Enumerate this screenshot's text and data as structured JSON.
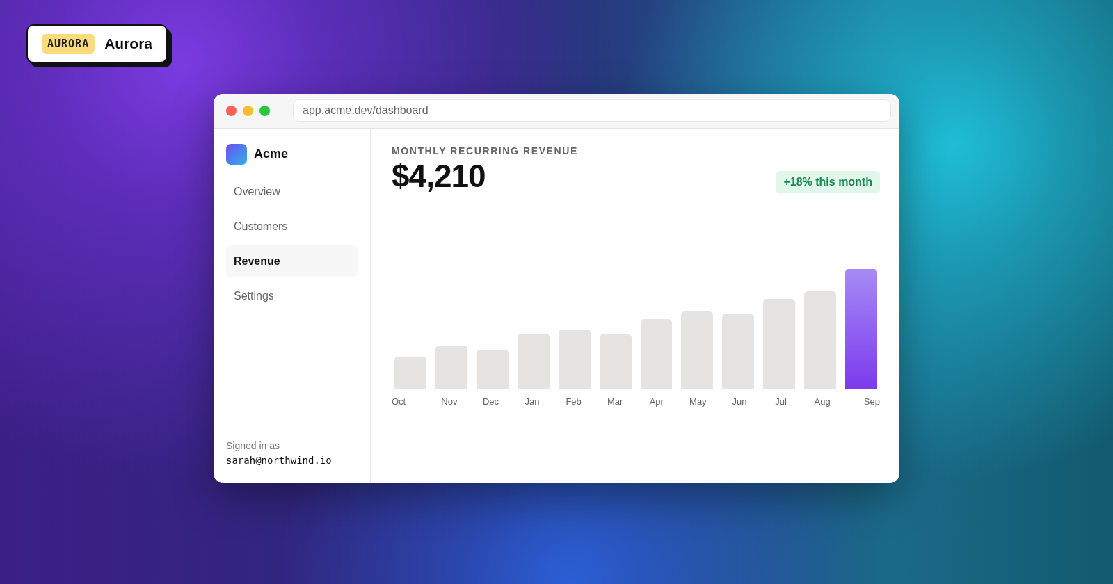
{
  "theme_badge": {
    "tag": "AURORA",
    "label": "Aurora"
  },
  "browser": {
    "url": "app.acme.dev/dashboard"
  },
  "sidebar": {
    "brand": "Acme",
    "items": [
      {
        "label": "Overview",
        "selected": false
      },
      {
        "label": "Customers",
        "selected": false
      },
      {
        "label": "Revenue",
        "selected": true
      },
      {
        "label": "Settings",
        "selected": false
      }
    ],
    "signed_in_label": "Signed in as",
    "user_email": "sarah@northwind.io"
  },
  "main": {
    "title": "MONTHLY RECURRING REVENUE",
    "amount": "$4,210",
    "change_badge": "+18% this month",
    "months": [
      {
        "label": "Oct",
        "highlighted": false
      },
      {
        "label": "Nov",
        "highlighted": false
      },
      {
        "label": "Dec",
        "highlighted": false
      },
      {
        "label": "Jan",
        "highlighted": false
      },
      {
        "label": "Feb",
        "highlighted": false
      },
      {
        "label": "Mar",
        "highlighted": false
      },
      {
        "label": "Apr",
        "highlighted": false
      },
      {
        "label": "May",
        "highlighted": false
      },
      {
        "label": "Jun",
        "highlighted": false
      },
      {
        "label": "Jul",
        "highlighted": false
      },
      {
        "label": "Aug",
        "highlighted": false
      },
      {
        "label": "Sep",
        "highlighted": true
      }
    ]
  }
}
